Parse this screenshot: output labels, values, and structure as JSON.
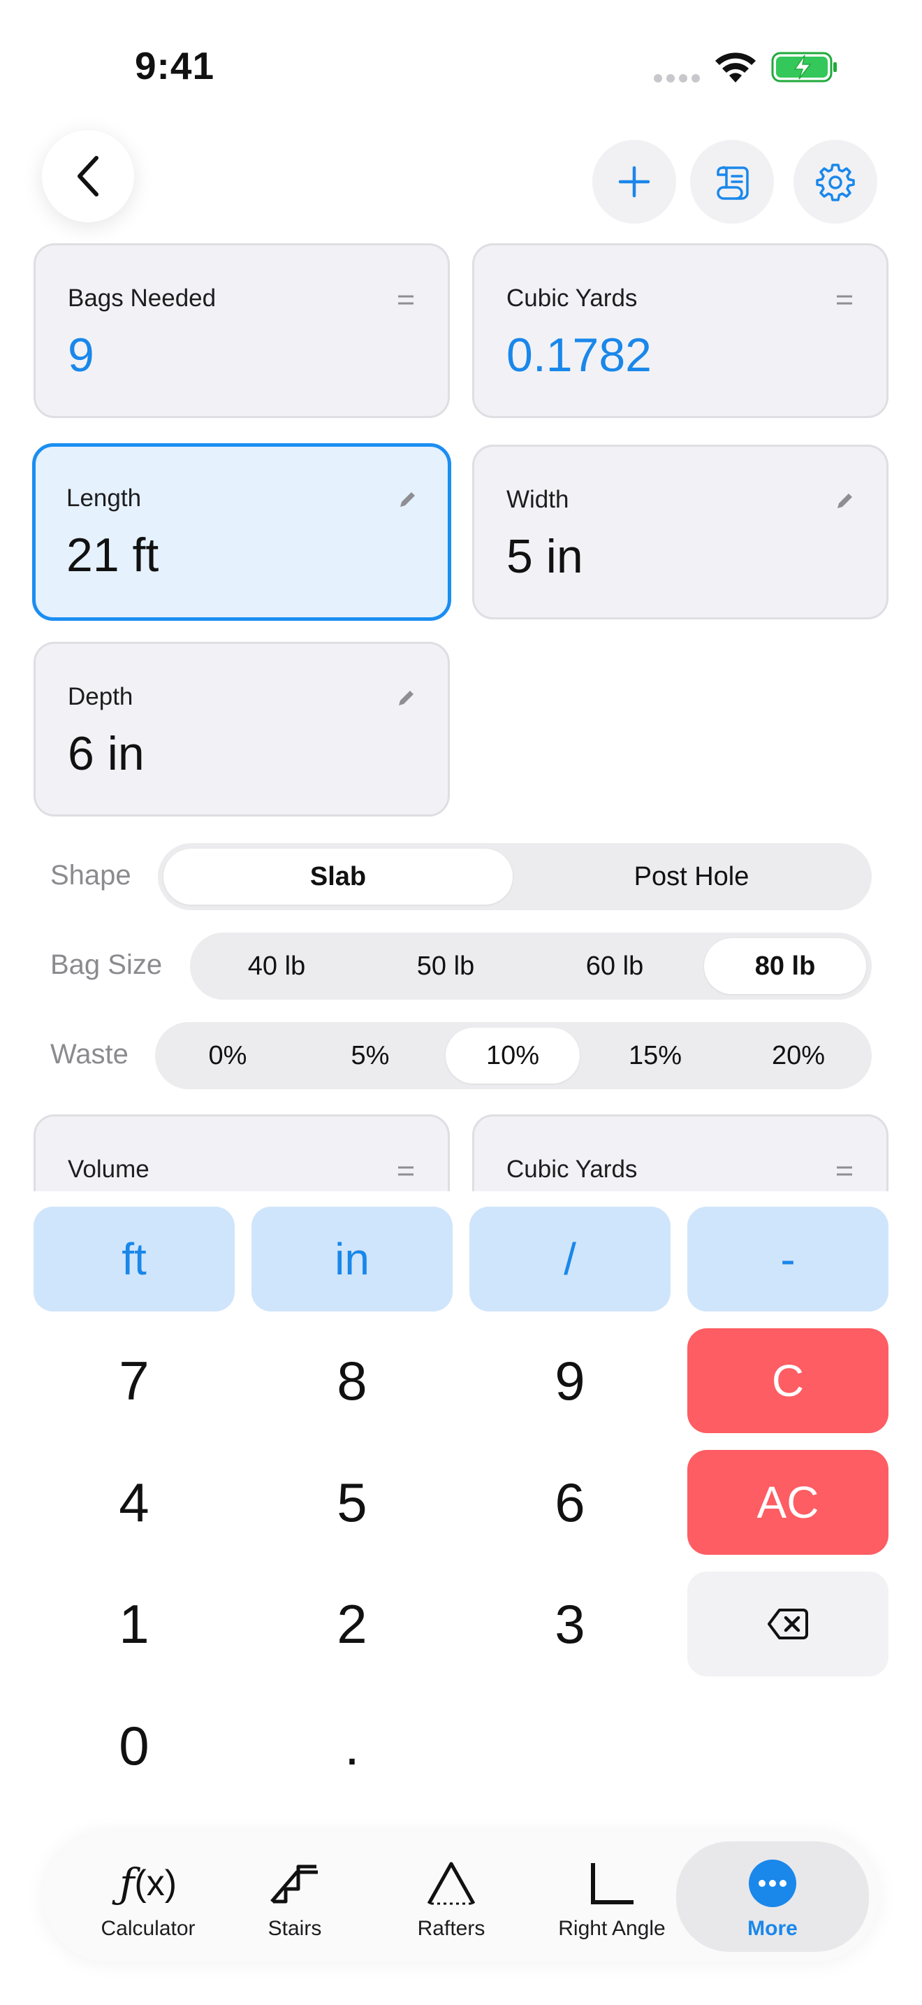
{
  "status_bar": {
    "time": "9:41"
  },
  "cards": [
    {
      "label": "Bags Needed",
      "value": "9"
    },
    {
      "label": "Cubic Yards",
      "value": "0.1782"
    },
    {
      "label": "Length",
      "value": "21 ft"
    },
    {
      "label": "Width",
      "value": "5 in"
    },
    {
      "label": "Depth",
      "value": "6 in"
    },
    {
      "label": "Volume",
      "value": ""
    },
    {
      "label": "Cubic Yards",
      "value": ""
    }
  ],
  "shape": {
    "label": "Shape",
    "options": [
      "Slab",
      "Post Hole"
    ],
    "selected": "Slab"
  },
  "bag_size": {
    "label": "Bag Size",
    "options": [
      "40 lb",
      "50 lb",
      "60 lb",
      "80 lb"
    ],
    "selected": "80 lb"
  },
  "waste": {
    "label": "Waste",
    "options": [
      "0%",
      "5%",
      "10%",
      "15%",
      "20%"
    ],
    "selected": "10%"
  },
  "keypad": {
    "units": [
      "ft",
      "in",
      "/",
      "-"
    ],
    "digits": [
      "7",
      "8",
      "9",
      "4",
      "5",
      "6",
      "1",
      "2",
      "3",
      "0",
      "."
    ],
    "clear": "C",
    "all_clear": "AC"
  },
  "tabs": [
    {
      "label": "Calculator",
      "icon": "fx-icon"
    },
    {
      "label": "Stairs",
      "icon": "stairs-icon"
    },
    {
      "label": "Rafters",
      "icon": "rafters-icon"
    },
    {
      "label": "Right Angle",
      "icon": "right-angle-icon"
    },
    {
      "label": "More",
      "icon": "more-icon"
    }
  ],
  "colors": {
    "accent": "#1a87ea",
    "destructive": "#fd5d63",
    "unit_key_bg": "#cfe5fb",
    "active_card_bg": "#e5f1fd"
  }
}
